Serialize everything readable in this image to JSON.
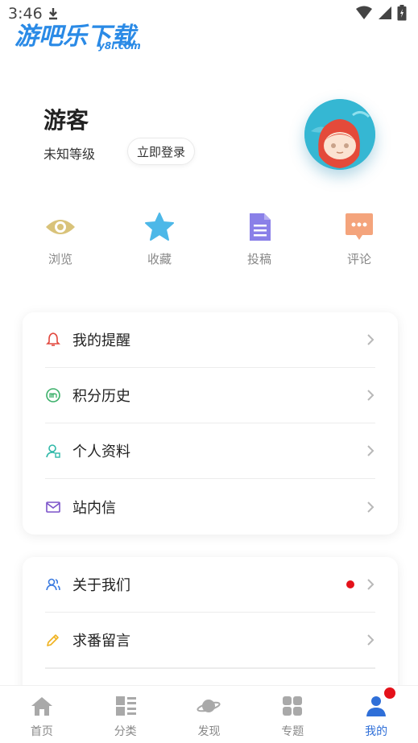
{
  "status_bar": {
    "time": "3:46"
  },
  "watermark": {
    "title": "游吧乐下载",
    "sub": "y8l.com"
  },
  "profile": {
    "name": "游客",
    "level": "未知等级",
    "login_label": "立即登录"
  },
  "quick_actions": [
    {
      "label": "浏览",
      "icon": "eye-icon",
      "color": "#d9c37a"
    },
    {
      "label": "收藏",
      "icon": "star-icon",
      "color": "#4db8e8"
    },
    {
      "label": "投稿",
      "icon": "document-icon",
      "color": "#8a80e8"
    },
    {
      "label": "评论",
      "icon": "comment-icon",
      "color": "#f4a47c"
    }
  ],
  "menu_group_1": [
    {
      "label": "我的提醒",
      "icon": "bell-icon"
    },
    {
      "label": "积分历史",
      "icon": "points-icon"
    },
    {
      "label": "个人资料",
      "icon": "profile-icon"
    },
    {
      "label": "站内信",
      "icon": "mail-icon"
    }
  ],
  "menu_group_2": [
    {
      "label": "关于我们",
      "icon": "users-icon",
      "badge": true
    },
    {
      "label": "求番留言",
      "icon": "pencil-icon"
    }
  ],
  "bottom_nav": [
    {
      "label": "首页",
      "icon": "home-icon"
    },
    {
      "label": "分类",
      "icon": "category-icon"
    },
    {
      "label": "发现",
      "icon": "planet-icon"
    },
    {
      "label": "专题",
      "icon": "grid-icon"
    },
    {
      "label": "我的",
      "icon": "user-icon",
      "active": true
    }
  ],
  "colors": {
    "accent": "#2f6fd8",
    "badge": "#e4111a"
  }
}
